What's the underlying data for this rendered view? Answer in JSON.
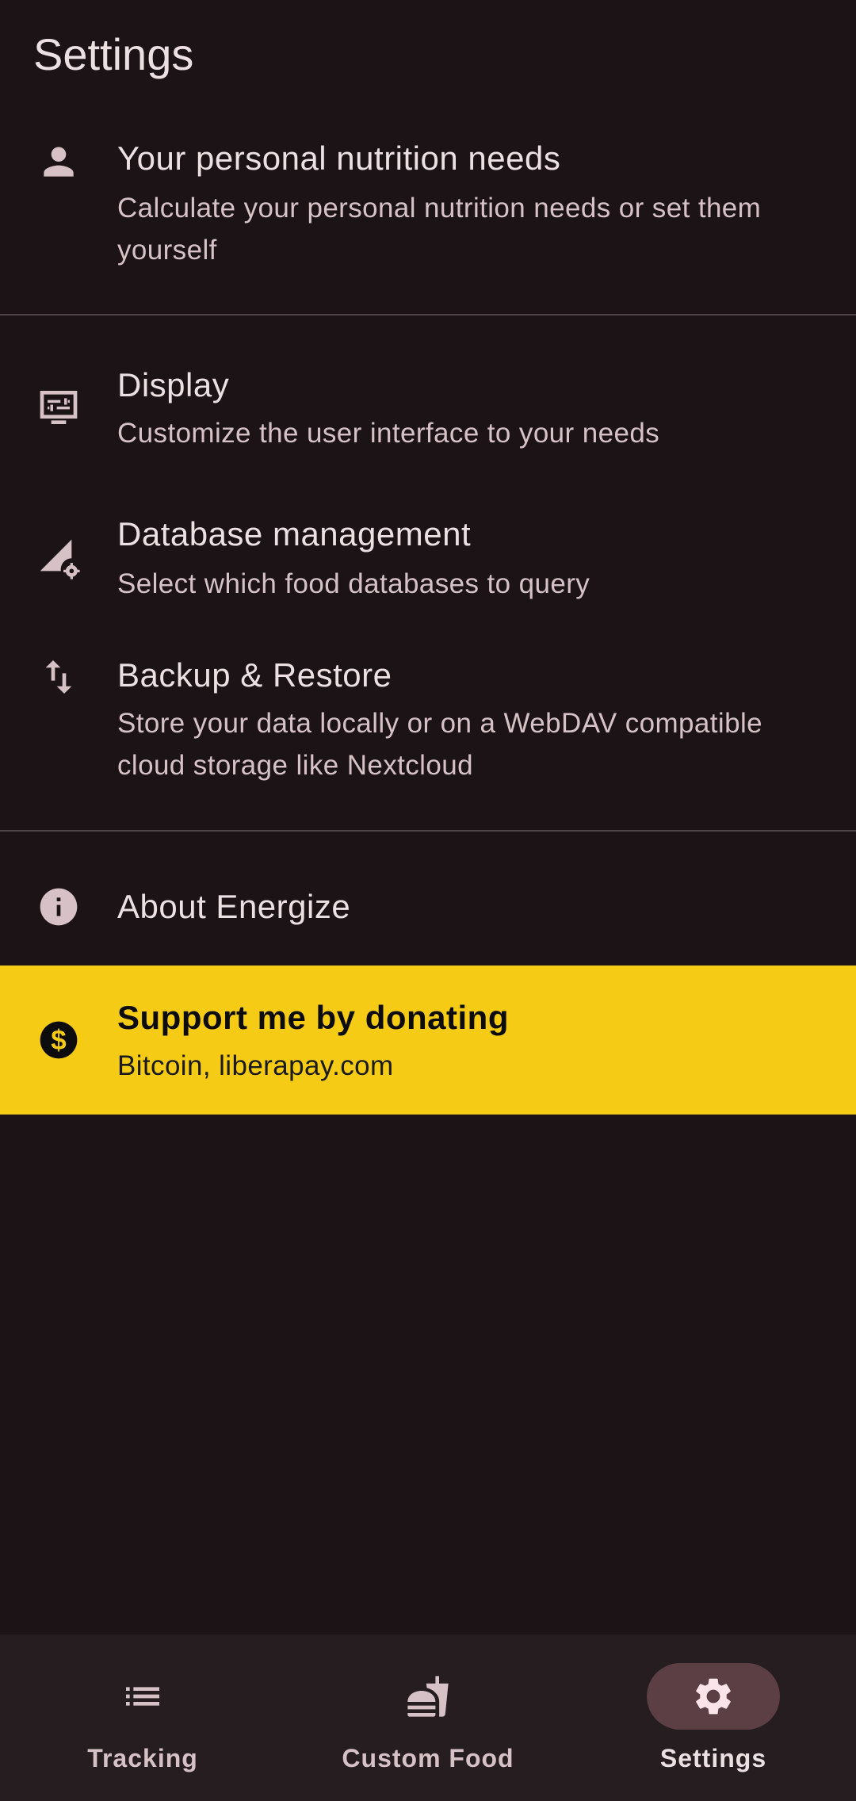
{
  "header": {
    "title": "Settings"
  },
  "items": [
    {
      "key": "nutrition",
      "icon": "person-icon",
      "title": "Your personal nutrition needs",
      "subtitle": "Calculate your personal nutrition needs or set them yourself"
    },
    {
      "key": "display",
      "icon": "display-settings-icon",
      "title": "Display",
      "subtitle": "Customize the user interface to your needs"
    },
    {
      "key": "database",
      "icon": "signal-cellular-settings-icon",
      "title": "Database management",
      "subtitle": "Select which food databases to query"
    },
    {
      "key": "backup",
      "icon": "swap-vert-icon",
      "title": "Backup & Restore",
      "subtitle": "Store your data locally or on a WebDAV compatible cloud storage like Nextcloud"
    },
    {
      "key": "about",
      "icon": "info-icon",
      "title": "About Energize"
    }
  ],
  "donate": {
    "icon": "dollar-circle-icon",
    "title": "Support me by donating",
    "subtitle": "Bitcoin, liberapay.com",
    "background": "#f5cb16"
  },
  "bottom_nav": {
    "items": [
      {
        "label": "Tracking",
        "icon": "list-icon",
        "active": false
      },
      {
        "label": "Custom Food",
        "icon": "fastfood-icon",
        "active": false
      },
      {
        "label": "Settings",
        "icon": "gear-icon",
        "active": true
      }
    ]
  },
  "colors": {
    "background": "#1b1315",
    "text_primary": "#ede0e2",
    "text_secondary": "#d6c2c6",
    "nav_background": "#261d20",
    "nav_active_pill": "#5b3f45",
    "accent_yellow": "#f5cb16"
  }
}
